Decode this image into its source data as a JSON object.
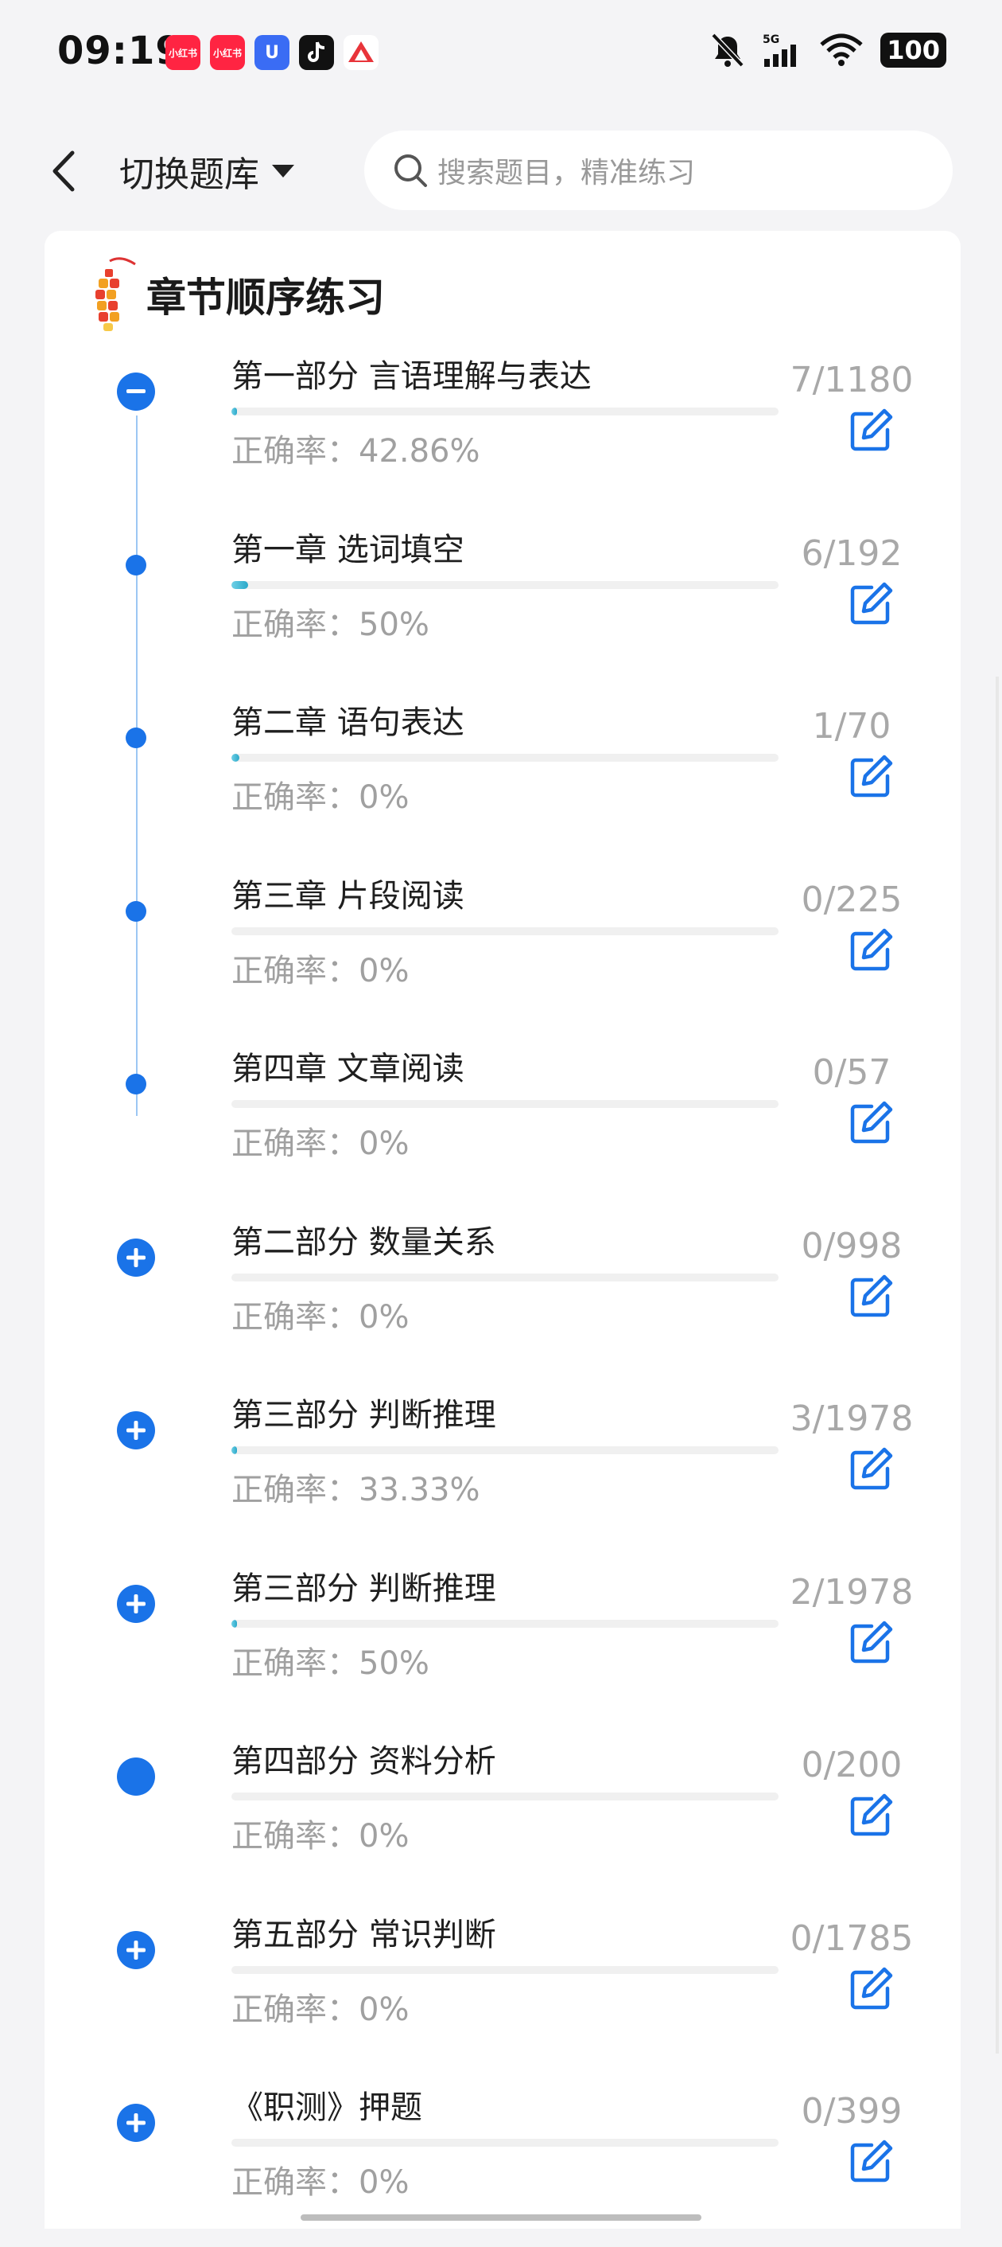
{
  "status": {
    "time": "09:19",
    "battery": "100",
    "network": "5G",
    "apps": [
      {
        "name": "小红书",
        "color": "#ff2442"
      },
      {
        "name": "小红书",
        "color": "#ff2442"
      },
      {
        "name": "U",
        "color": "#3a6cf4"
      },
      {
        "name": "tiktok",
        "color": "#111111"
      },
      {
        "name": "A",
        "color": "#ffffff"
      }
    ]
  },
  "header": {
    "title": "切换题库",
    "search_placeholder": "搜索题目，精准练习"
  },
  "section": {
    "title": "章节顺序练习"
  },
  "rows": [
    {
      "title": "第一部分 言语理解与表达",
      "accuracy": "正确率：42.86%",
      "count": "7/1180",
      "progress": 0.006,
      "node": "minus"
    },
    {
      "title": "第一章 选词填空",
      "accuracy": "正确率：50%",
      "count": "6/192",
      "progress": 0.031,
      "node": "dot"
    },
    {
      "title": "第二章 语句表达",
      "accuracy": "正确率：0%",
      "count": "1/70",
      "progress": 0.014,
      "node": "dot"
    },
    {
      "title": "第三章 片段阅读",
      "accuracy": "正确率：0%",
      "count": "0/225",
      "progress": 0,
      "node": "dot"
    },
    {
      "title": "第四章 文章阅读",
      "accuracy": "正确率：0%",
      "count": "0/57",
      "progress": 0,
      "node": "dot"
    },
    {
      "title": "第二部分 数量关系",
      "accuracy": "正确率：0%",
      "count": "0/998",
      "progress": 0,
      "node": "plus"
    },
    {
      "title": "第三部分 判断推理",
      "accuracy": "正确率：33.33%",
      "count": "3/1978",
      "progress": 0.0015,
      "node": "plus"
    },
    {
      "title": "第三部分 判断推理",
      "accuracy": "正确率：50%",
      "count": "2/1978",
      "progress": 0.001,
      "node": "plus"
    },
    {
      "title": "第四部分 资料分析",
      "accuracy": "正确率：0%",
      "count": "0/200",
      "progress": 0,
      "node": "filled"
    },
    {
      "title": "第五部分 常识判断",
      "accuracy": "正确率：0%",
      "count": "0/1785",
      "progress": 0,
      "node": "plus"
    },
    {
      "title": "《职测》押题",
      "accuracy": "正确率：0%",
      "count": "0/399",
      "progress": 0,
      "node": "plus"
    }
  ],
  "colors": {
    "accent": "#1a73e8",
    "progress": "#2aa8c9"
  }
}
